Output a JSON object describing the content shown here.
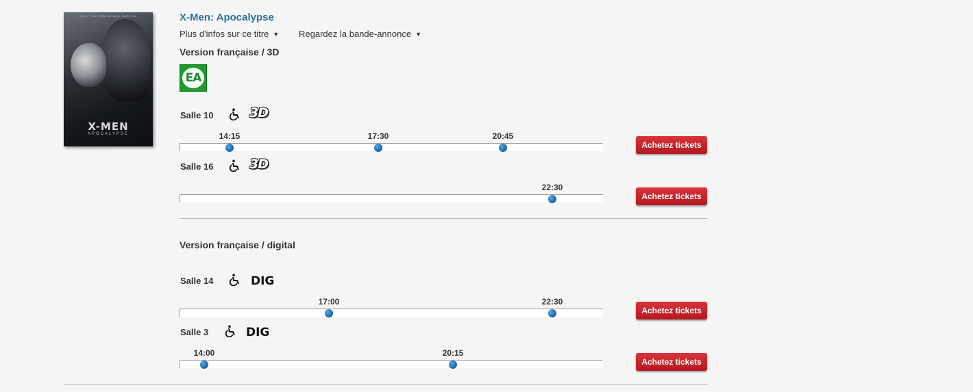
{
  "movie": {
    "title": "X-Men: Apocalypse",
    "poster": {
      "tagline": "ONLY THE STRONG WILL SURVIVE",
      "title": "X-MEN",
      "subtitle": "APOCALYPSE"
    },
    "links": {
      "more_info": "Plus d'infos sur ce titre",
      "trailer": "Regardez la bande-annonce"
    }
  },
  "colors": {
    "title": "#2c6ea0",
    "ticket_button": "#c4232a",
    "showtime_dot": "#1f6fb5",
    "ea_badge": "#1d9c2e"
  },
  "versions": [
    {
      "title": "Version française / 3D",
      "badge": "EA",
      "rooms": [
        {
          "label": "Salle 10",
          "format": "3D",
          "wheelchair_icon": "wheelchair-icon",
          "showtimes": [
            "14:15",
            "17:30",
            "20:45"
          ],
          "button": "Achetez tickets"
        },
        {
          "label": "Salle 16",
          "format": "3D",
          "wheelchair_icon": "wheelchair-icon",
          "showtimes": [
            "22:30"
          ],
          "button": "Achetez tickets"
        }
      ]
    },
    {
      "title": "Version française / digital",
      "rooms": [
        {
          "label": "Salle 14",
          "format": "DIG",
          "wheelchair_icon": "wheelchair-icon",
          "showtimes": [
            "17:00",
            "22:30"
          ],
          "button": "Achetez tickets"
        },
        {
          "label": "Salle 3",
          "format": "DIG",
          "wheelchair_icon": "wheelchair-icon",
          "showtimes": [
            "14:00",
            "20:15"
          ],
          "button": "Achetez tickets"
        }
      ]
    }
  ]
}
